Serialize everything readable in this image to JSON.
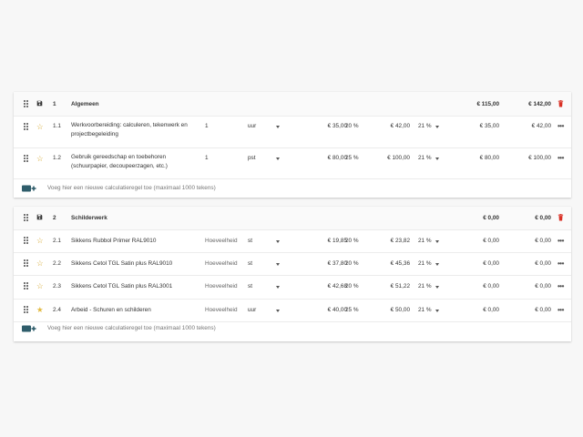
{
  "sections": [
    {
      "number": "1",
      "title": "Algemeen",
      "total_excl": "€ 115,00",
      "total_incl": "€ 142,00",
      "rows": [
        {
          "number": "1.1",
          "description": "Werkvoorbereiding: calculeren, tekenwerk en projectbegeleiding",
          "quantity": "1",
          "unit": "uur",
          "price": "€ 35,00",
          "margin": "20 %",
          "price_total": "€ 42,00",
          "vat": "21 %",
          "excl": "€ 35,00",
          "incl": "€ 42,00",
          "starred": false
        },
        {
          "number": "1.2",
          "description": "Gebruik gereedschap en toebehoren (schuurpapier, decoupeerzagen, etc.)",
          "quantity": "1",
          "unit": "pst",
          "price": "€ 80,00",
          "margin": "25 %",
          "price_total": "€ 100,00",
          "vat": "21 %",
          "excl": "€ 80,00",
          "incl": "€ 100,00",
          "starred": false
        }
      ],
      "add_text": "Voeg hier een nieuwe calculatieregel toe (maximaal 1000 tekens)"
    },
    {
      "number": "2",
      "title": "Schilderwerk",
      "total_excl": "€ 0,00",
      "total_incl": "€ 0,00",
      "rows": [
        {
          "number": "2.1",
          "description": "Sikkens Rubbol Primer RAL9010",
          "quantity": "Hoeveelheid",
          "unit": "st",
          "price": "€ 19,85",
          "margin": "20 %",
          "price_total": "€ 23,82",
          "vat": "21 %",
          "excl": "€ 0,00",
          "incl": "€ 0,00",
          "starred": false
        },
        {
          "number": "2.2",
          "description": "Sikkens Cetol TGL Satin plus RAL9010",
          "quantity": "Hoeveelheid",
          "unit": "st",
          "price": "€ 37,80",
          "margin": "20 %",
          "price_total": "€ 45,36",
          "vat": "21 %",
          "excl": "€ 0,00",
          "incl": "€ 0,00",
          "starred": false
        },
        {
          "number": "2.3",
          "description": "Sikkens Cetol TGL Satin plus RAL3001",
          "quantity": "Hoeveelheid",
          "unit": "st",
          "price": "€ 42,68",
          "margin": "20 %",
          "price_total": "€ 51,22",
          "vat": "21 %",
          "excl": "€ 0,00",
          "incl": "€ 0,00",
          "starred": false
        },
        {
          "number": "2.4",
          "description": "Arbeid - Schuren en schilderen",
          "quantity": "Hoeveelheid",
          "unit": "uur",
          "price": "€ 40,00",
          "margin": "25 %",
          "price_total": "€ 50,00",
          "vat": "21 %",
          "excl": "€ 0,00",
          "incl": "€ 0,00",
          "starred": true
        }
      ],
      "add_text": "Voeg hier een nieuwe calculatieregel toe (maximaal 1000 tekens)"
    }
  ],
  "icons": {
    "drag": "drag-handle-icon",
    "save": "save-icon",
    "star": "star-icon",
    "more": "more-horizontal-icon",
    "trash": "trash-icon",
    "add": "add-row-icon",
    "caret": "caret-down-icon"
  },
  "colors": {
    "trash": "#d93025",
    "star": "#d4a72c",
    "add_icon": "#2f5d6b"
  }
}
